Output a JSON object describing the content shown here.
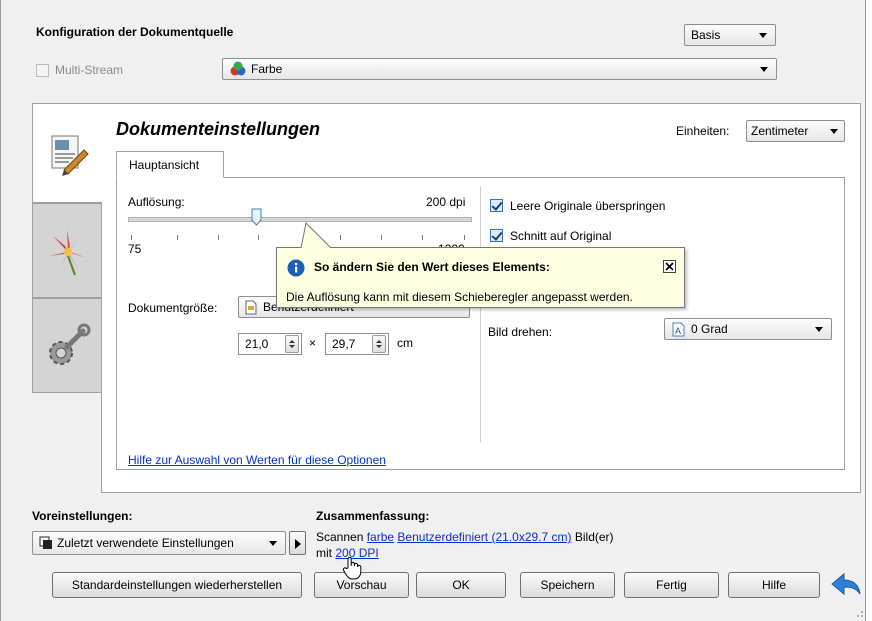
{
  "header": {
    "title": "Konfiguration der Dokumentquelle",
    "mode_select": "Basis",
    "multistream_label": "Multi-Stream",
    "color_select": "Farbe"
  },
  "document": {
    "title": "Dokumenteinstellungen",
    "units_label": "Einheiten:",
    "units_value": "Zentimeter",
    "tab_label": "Hauptansicht",
    "resolution_label": "Auflösung:",
    "resolution_value": "200 dpi",
    "slider_min": "75",
    "slider_max": "1200",
    "slider_level_dpi": 200,
    "docsize_label": "Dokumentgröße:",
    "docsize_value": "Benutzerdefiniert",
    "width_value": "21,0",
    "times": "×",
    "height_value": "29,7",
    "size_unit": "cm",
    "help_link": "Hilfe zur Auswahl von Werten für diese Optionen",
    "options": {
      "skip_blank": "Leere Originale überspringen",
      "crop_to_original": "Schnitt auf Original"
    },
    "rotate_label": "Bild drehen:",
    "rotate_value": "0 Grad"
  },
  "tooltip": {
    "title": "So ändern Sie den Wert dieses Elements:",
    "body": "Die Auflösung kann mit diesem Schieberegler angepasst werden."
  },
  "presets": {
    "label": "Voreinstellungen:",
    "value": "Zuletzt verwendete Einstellungen"
  },
  "summary": {
    "label": "Zusammenfassung:",
    "text_scan": "Scannen",
    "link_color": "farbe",
    "link_size": "Benutzerdefiniert (21.0x29.7 cm)",
    "text_images": "Bild(er)",
    "text_with": "mit",
    "link_dpi": "200 DPI"
  },
  "buttons": {
    "reset": "Standardeinstellungen wiederherstellen",
    "preview": "Vorschau",
    "ok": "OK",
    "save": "Speichern",
    "done": "Fertig",
    "help": "Hilfe"
  },
  "colors": {
    "link": "#0033cc",
    "tooltip_bg": "#ffffe1",
    "info_icon": "#1a5fb4",
    "back_arrow": "#2f7fd6"
  }
}
